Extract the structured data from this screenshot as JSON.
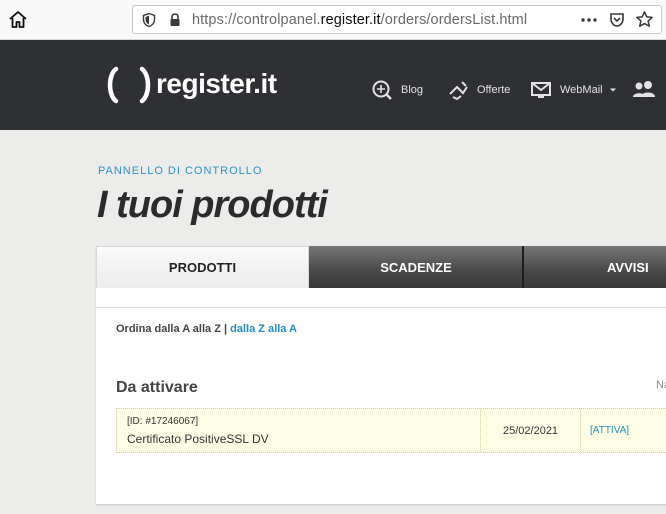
{
  "browser": {
    "url_prefix": "https://controlpanel.",
    "url_domain": "register.it",
    "url_path": "/orders/ordersList.html"
  },
  "site": {
    "logo_text": "register.it",
    "nav": [
      {
        "label": "Blog",
        "icon": "blog-icon"
      },
      {
        "label": "Offerte",
        "icon": "offers-icon"
      },
      {
        "label": "WebMail",
        "icon": "mail-icon"
      },
      {
        "label": "",
        "icon": "users-icon"
      }
    ]
  },
  "page": {
    "breadcrumb": "PANNELLO DI CONTROLLO",
    "title": "I tuoi prodotti"
  },
  "tabs": [
    {
      "label": "PRODOTTI",
      "active": true
    },
    {
      "label": "SCADENZE",
      "active": false
    },
    {
      "label": "AVVISI",
      "active": false
    }
  ],
  "sort": {
    "label": "Ordina dalla A alla Z |",
    "link": "dalla Z alla A"
  },
  "section": {
    "title": "Da attivare",
    "right_label": "Na"
  },
  "orders": [
    {
      "id": "[ID: #17246067]",
      "name": "Certificato PositiveSSL DV",
      "date": "25/02/2021",
      "action": "[ATTIVA]"
    }
  ],
  "colors": {
    "header_bg": "#2e3033",
    "accent": "#2a95c3",
    "row_bg": "#fdfde6"
  }
}
